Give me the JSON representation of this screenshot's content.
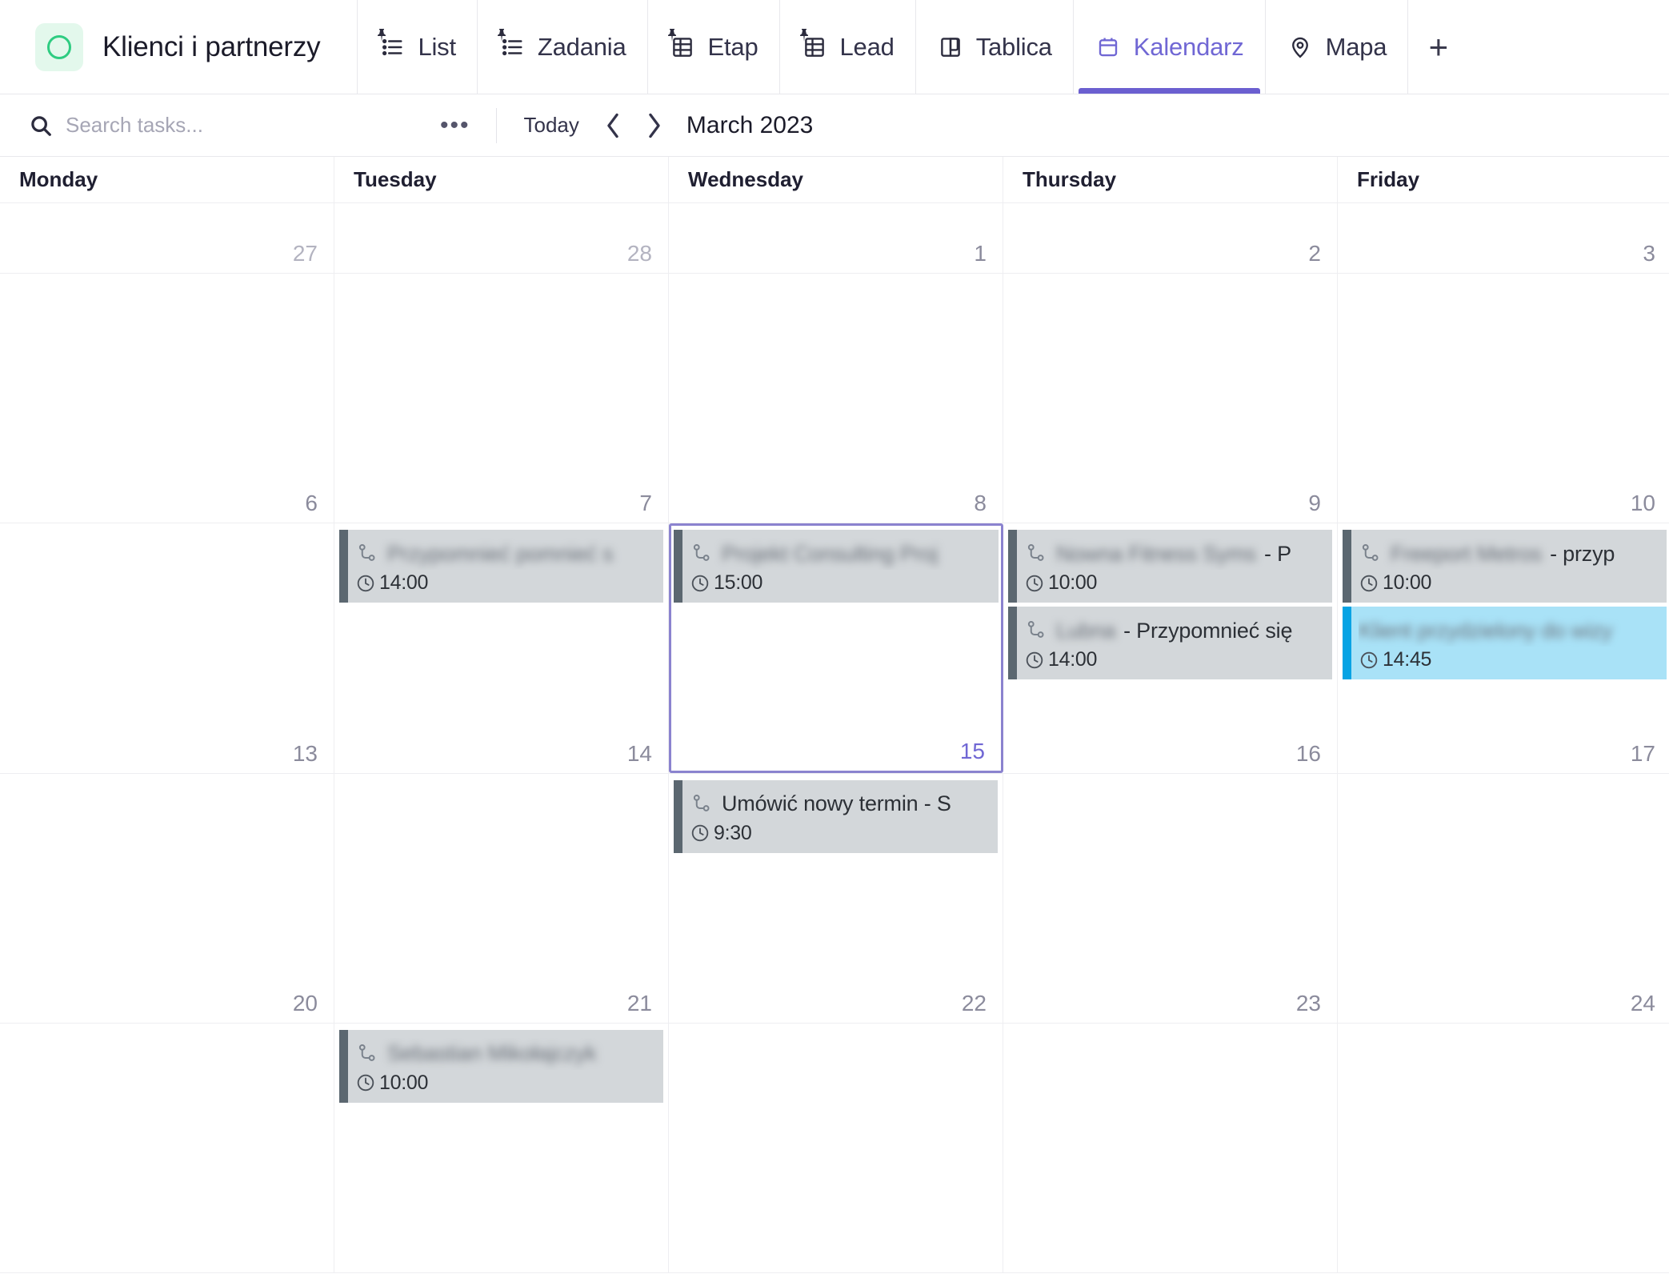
{
  "header": {
    "space_title": "Klienci i partnerzy",
    "space_icon": "circle-outline-icon",
    "add_view_label": "+",
    "tabs": [
      {
        "label": "List",
        "icon": "list-view-icon",
        "pinned": true,
        "active": false
      },
      {
        "label": "Zadania",
        "icon": "list-view-icon",
        "pinned": true,
        "active": false
      },
      {
        "label": "Etap",
        "icon": "table-view-icon",
        "pinned": true,
        "active": false
      },
      {
        "label": "Lead",
        "icon": "table-view-icon",
        "pinned": true,
        "active": false
      },
      {
        "label": "Tablica",
        "icon": "board-view-icon",
        "pinned": false,
        "active": false
      },
      {
        "label": "Kalendarz",
        "icon": "calendar-view-icon",
        "pinned": false,
        "active": true
      },
      {
        "label": "Mapa",
        "icon": "map-pin-icon",
        "pinned": false,
        "active": false
      }
    ]
  },
  "toolbar": {
    "search_placeholder": "Search tasks...",
    "search_value": "",
    "more_label": "•••",
    "today_label": "Today",
    "prev_label": "‹",
    "next_label": "›",
    "period_label": "March 2023"
  },
  "calendar": {
    "weekday_headers": [
      "Monday",
      "Tuesday",
      "Wednesday",
      "Thursday",
      "Friday"
    ],
    "weeks": [
      {
        "days": [
          {
            "num": "27",
            "dim": true,
            "today": false,
            "events": []
          },
          {
            "num": "28",
            "dim": true,
            "today": false,
            "events": []
          },
          {
            "num": "1",
            "dim": false,
            "today": false,
            "events": []
          },
          {
            "num": "2",
            "dim": false,
            "today": false,
            "events": []
          },
          {
            "num": "3",
            "dim": false,
            "today": false,
            "events": []
          }
        ]
      },
      {
        "days": [
          {
            "num": "6",
            "dim": false,
            "today": false,
            "events": []
          },
          {
            "num": "7",
            "dim": false,
            "today": false,
            "events": []
          },
          {
            "num": "8",
            "dim": false,
            "today": false,
            "events": []
          },
          {
            "num": "9",
            "dim": false,
            "today": false,
            "events": []
          },
          {
            "num": "10",
            "dim": false,
            "today": false,
            "events": []
          }
        ]
      },
      {
        "days": [
          {
            "num": "13",
            "dim": false,
            "today": false,
            "events": []
          },
          {
            "num": "14",
            "dim": false,
            "today": false,
            "events": [
              {
                "title": "Przypomnieć pomnieć s",
                "title_redacted": true,
                "time": "14:00",
                "color": "gray",
                "subtask_icon": "subtask-icon",
                "clock_icon": "clock-icon"
              }
            ]
          },
          {
            "num": "15",
            "dim": false,
            "today": true,
            "events": [
              {
                "title": "Projekt Consulting Proj",
                "title_redacted": true,
                "time": "15:00",
                "color": "gray",
                "subtask_icon": "subtask-icon",
                "clock_icon": "clock-icon"
              }
            ]
          },
          {
            "num": "16",
            "dim": false,
            "today": false,
            "events": [
              {
                "title": "Nowna Fitness Syms",
                "title_suffix": " - P",
                "title_redacted": true,
                "time": "10:00",
                "color": "gray",
                "subtask_icon": "subtask-icon",
                "clock_icon": "clock-icon"
              },
              {
                "title": "Lubna",
                "title_suffix": " - Przypomnieć się",
                "title_redacted": true,
                "time": "14:00",
                "color": "gray",
                "subtask_icon": "subtask-icon",
                "clock_icon": "clock-icon"
              }
            ]
          },
          {
            "num": "17",
            "dim": false,
            "today": false,
            "events": [
              {
                "title": "Freeport Metros",
                "title_suffix": " - przyp",
                "title_redacted": true,
                "time": "10:00",
                "color": "gray",
                "subtask_icon": "subtask-icon",
                "clock_icon": "clock-icon"
              },
              {
                "title": "Klient przydzielony do wizy",
                "title_redacted": true,
                "time": "14:45",
                "color": "blue",
                "subtask_icon": "",
                "clock_icon": "clock-icon"
              }
            ]
          }
        ]
      },
      {
        "days": [
          {
            "num": "20",
            "dim": false,
            "today": false,
            "events": []
          },
          {
            "num": "21",
            "dim": false,
            "today": false,
            "events": []
          },
          {
            "num": "22",
            "dim": false,
            "today": false,
            "events": [
              {
                "title": "Umówić nowy termin - S",
                "title_redacted": false,
                "time": "9:30",
                "color": "gray",
                "subtask_icon": "subtask-icon",
                "clock_icon": "clock-icon"
              }
            ]
          },
          {
            "num": "23",
            "dim": false,
            "today": false,
            "events": []
          },
          {
            "num": "24",
            "dim": false,
            "today": false,
            "events": []
          }
        ]
      },
      {
        "days": [
          {
            "num": "",
            "dim": false,
            "today": false,
            "events": []
          },
          {
            "num": "",
            "dim": false,
            "today": false,
            "events": [
              {
                "title": "Sebastian Mikołajczyk",
                "title_redacted": true,
                "time": "10:00",
                "color": "gray",
                "subtask_icon": "subtask-icon",
                "clock_icon": "clock-icon"
              }
            ]
          },
          {
            "num": "",
            "dim": false,
            "today": false,
            "events": []
          },
          {
            "num": "",
            "dim": false,
            "today": false,
            "events": []
          },
          {
            "num": "",
            "dim": false,
            "today": false,
            "events": []
          }
        ]
      }
    ]
  },
  "colors": {
    "accent_purple": "#6b5fd0",
    "tab_active_text": "#7067d4",
    "today_border": "#8b83cf",
    "event_gray_bg": "#d3d7da",
    "event_gray_bar": "#5b6770",
    "event_blue_bg": "#a9e2f7",
    "event_blue_bar": "#05a3e4",
    "brand_green": "#2ecc81"
  }
}
